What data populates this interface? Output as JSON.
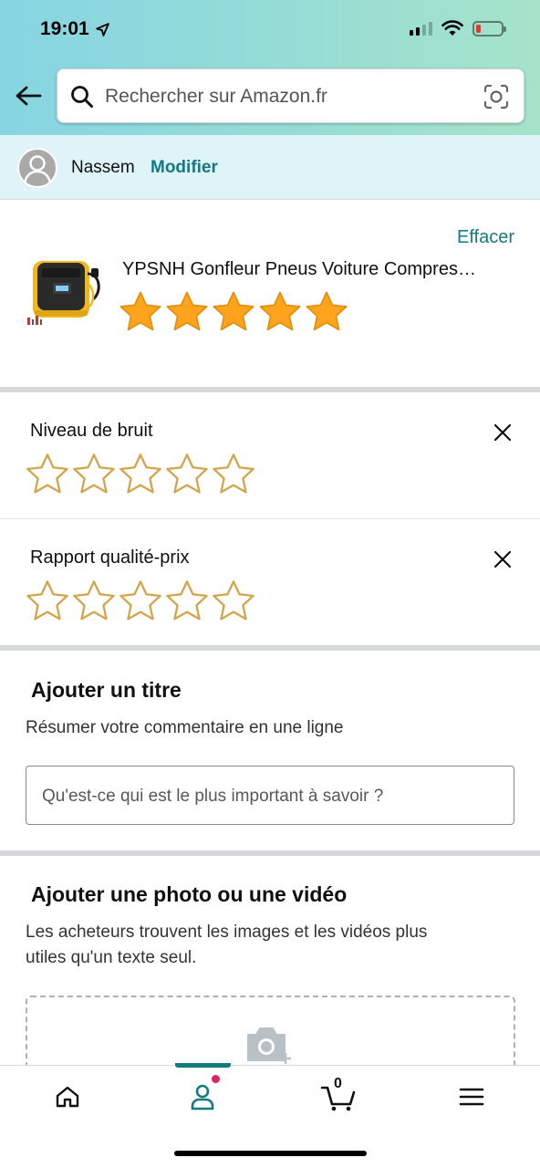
{
  "status_bar": {
    "time": "19:01"
  },
  "search": {
    "placeholder": "Rechercher sur Amazon.fr"
  },
  "user": {
    "name": "Nassem",
    "modify_label": "Modifier"
  },
  "product": {
    "erase_label": "Effacer",
    "title": "YPSNH Gonfleur Pneus Voiture Compres…",
    "overall_rating": 5,
    "max_rating": 5
  },
  "ratings": [
    {
      "label": "Niveau de bruit",
      "value": 0,
      "max": 5
    },
    {
      "label": "Rapport qualité-prix",
      "value": 0,
      "max": 5
    }
  ],
  "title_section": {
    "heading": "Ajouter un titre",
    "subtitle": "Résumer votre commentaire en une ligne",
    "input_placeholder": "Qu'est-ce qui est le plus important à savoir ?"
  },
  "media_section": {
    "heading": "Ajouter une photo ou une vidéo",
    "subtitle_line1": "Les acheteurs trouvent les images et les vidéos plus",
    "subtitle_line2": "utiles qu'un texte seul."
  },
  "bottom_nav": {
    "items": [
      "home-icon",
      "account-icon",
      "cart-icon",
      "menu-icon"
    ],
    "cart_count": "0",
    "active": "account"
  },
  "colors": {
    "accent": "#137a7f",
    "star_fill": "#ffa41c",
    "star_outline": "#d4a44a",
    "badge": "#e0245e"
  }
}
